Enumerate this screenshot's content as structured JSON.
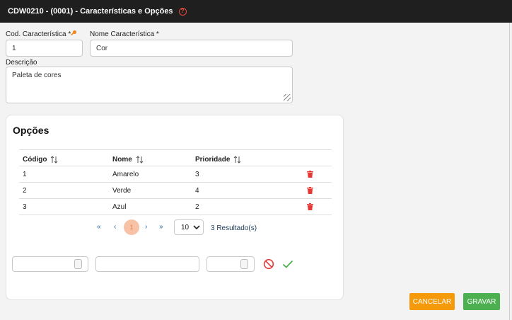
{
  "window": {
    "title": "CDW0210  - (0001) - Características e Opções"
  },
  "form": {
    "cod_label": "Cod. Característica *",
    "cod_value": "1",
    "nome_label": "Nome Característica *",
    "nome_value": "Cor",
    "descricao_label": "Descrição",
    "descricao_value": "Paleta de cores"
  },
  "opcoes": {
    "title": "Opções",
    "columns": [
      "Código",
      "Nome",
      "Prioridade"
    ],
    "rows": [
      {
        "codigo": "1",
        "nome": "Amarelo",
        "prioridade": "3"
      },
      {
        "codigo": "2",
        "nome": "Verde",
        "prioridade": "4"
      },
      {
        "codigo": "3",
        "nome": "Azul",
        "prioridade": "2"
      }
    ],
    "pagination": {
      "first": "«",
      "prev": "‹",
      "current_page": "1",
      "next": "›",
      "last": "»",
      "page_size": "10",
      "results": "3 Resultado(s)"
    },
    "new_row": {
      "codigo": "",
      "nome": "",
      "prioridade": ""
    }
  },
  "actions": {
    "cancel_label": "CANCELAR",
    "save_label": "GRAVAR"
  },
  "colors": {
    "titlebar": "#1f1f1f",
    "help": "#e74c3c",
    "key": "#f08a24",
    "trash": "#e53935",
    "cancel": "#f59a0b",
    "save": "#4caf50",
    "page_active_bg": "#f8c2a6"
  },
  "icons": {
    "help": "question-circle-icon",
    "key": "key-icon",
    "sort": "sort-arrows-icon",
    "trash": "trash-icon",
    "cancel_row": "ban-icon",
    "confirm_row": "check-icon"
  }
}
